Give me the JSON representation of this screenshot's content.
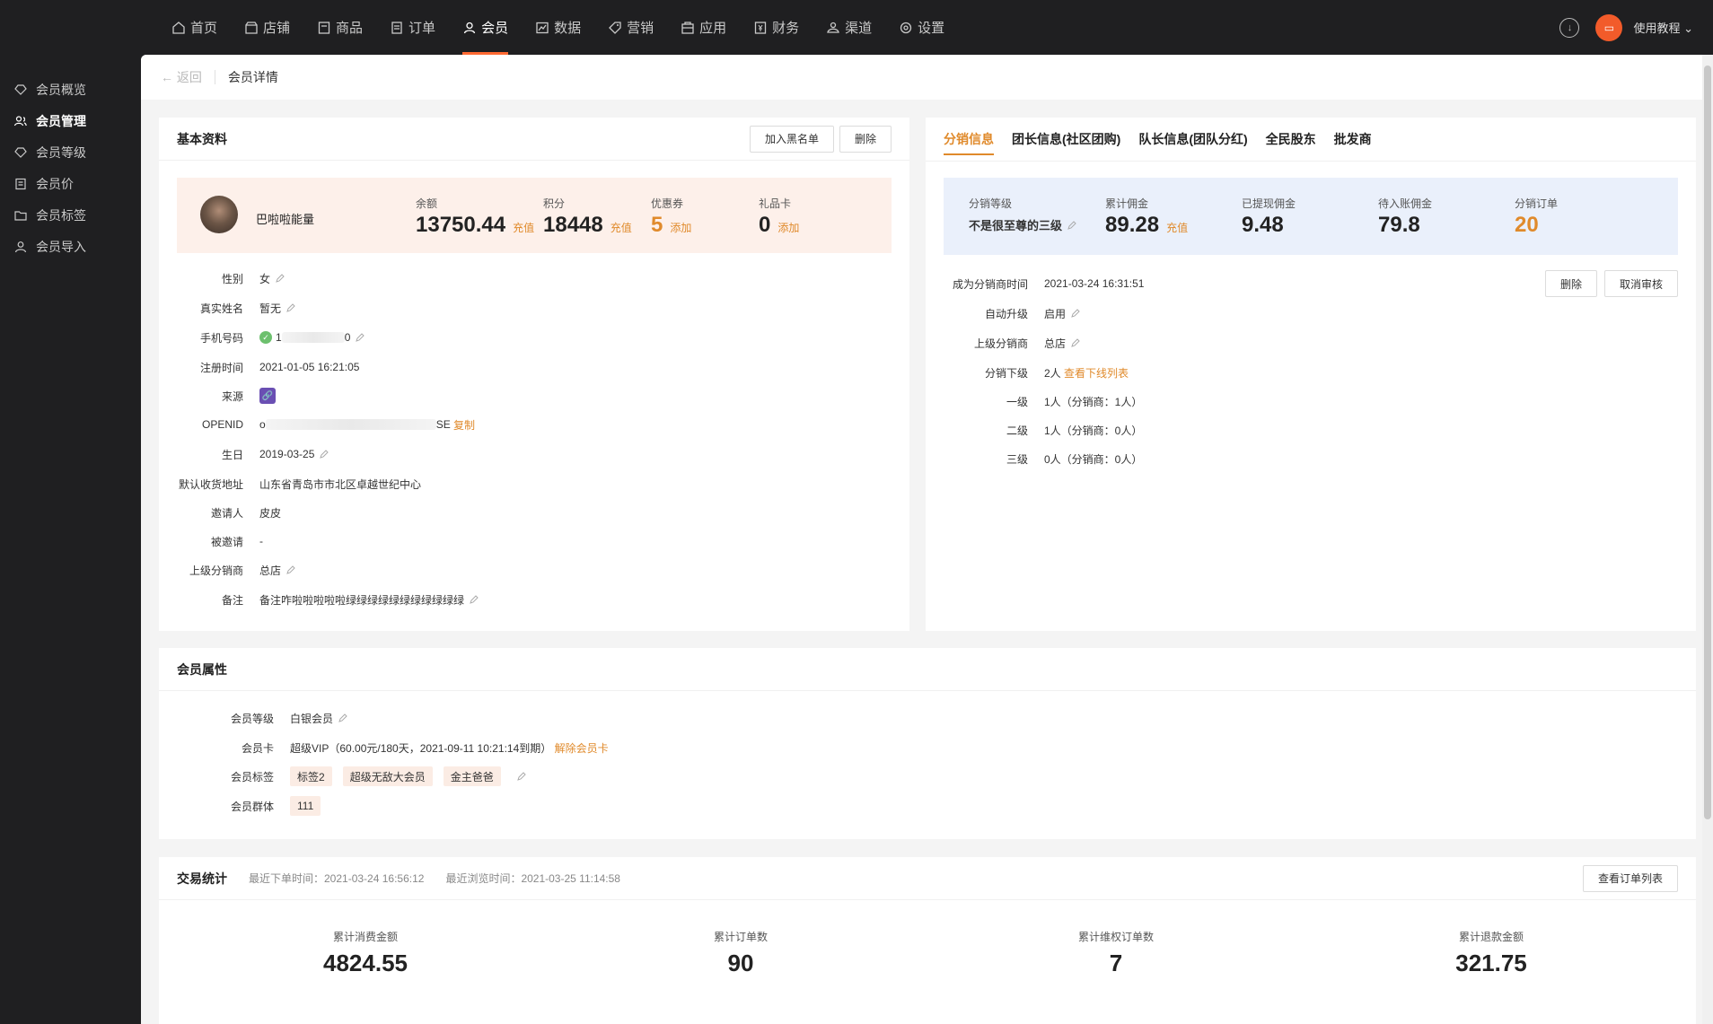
{
  "topnav": {
    "items": [
      {
        "label": "首页",
        "icon": "home-icon"
      },
      {
        "label": "店铺",
        "icon": "store-icon"
      },
      {
        "label": "商品",
        "icon": "goods-icon"
      },
      {
        "label": "订单",
        "icon": "order-icon"
      },
      {
        "label": "会员",
        "icon": "member-icon"
      },
      {
        "label": "数据",
        "icon": "chart-icon"
      },
      {
        "label": "营销",
        "icon": "tag-icon"
      },
      {
        "label": "应用",
        "icon": "app-icon"
      },
      {
        "label": "财务",
        "icon": "finance-icon"
      },
      {
        "label": "渠道",
        "icon": "channel-icon"
      },
      {
        "label": "设置",
        "icon": "gear-icon"
      }
    ],
    "active": "会员",
    "help_label": "使用教程"
  },
  "sidebar": {
    "items": [
      {
        "label": "会员概览"
      },
      {
        "label": "会员管理"
      },
      {
        "label": "会员等级"
      },
      {
        "label": "会员价"
      },
      {
        "label": "会员标签"
      },
      {
        "label": "会员导入"
      }
    ],
    "active": "会员管理"
  },
  "breadcrumb": {
    "back": "返回",
    "title": "会员详情"
  },
  "basic": {
    "title": "基本资料",
    "blacklist_btn": "加入黑名单",
    "delete_btn": "删除",
    "nickname": "巴啦啦能量",
    "stats": [
      {
        "label": "余额",
        "value": "13750.44",
        "action": "充值"
      },
      {
        "label": "积分",
        "value": "18448",
        "action": "充值"
      },
      {
        "label": "优惠券",
        "value": "5",
        "action": "添加"
      },
      {
        "label": "礼品卡",
        "value": "0",
        "action": "添加"
      }
    ],
    "rows": {
      "gender": {
        "k": "性别",
        "v": "女"
      },
      "realname": {
        "k": "真实姓名",
        "v": "暂无"
      },
      "phone": {
        "k": "手机号码",
        "v_start": "1",
        "v_end": "0"
      },
      "regtime": {
        "k": "注册时间",
        "v": "2021-01-05 16:21:05"
      },
      "source": {
        "k": "来源"
      },
      "openid": {
        "k": "OPENID",
        "v_start": "o",
        "v_end": "SE",
        "action": "复制"
      },
      "birthday": {
        "k": "生日",
        "v": "2019-03-25"
      },
      "address": {
        "k": "默认收货地址",
        "v": "山东省青岛市市北区卓越世纪中心"
      },
      "inviter": {
        "k": "邀请人",
        "v": "皮皮"
      },
      "invited": {
        "k": "被邀请",
        "v": "-"
      },
      "upline": {
        "k": "上级分销商",
        "v": "总店"
      },
      "remark": {
        "k": "备注",
        "v": "备注咋啦啦啦啦啦绿绿绿绿绿绿绿绿绿绿绿"
      }
    }
  },
  "distribution": {
    "tabs": [
      "分销信息",
      "团长信息(社区团购)",
      "队长信息(团队分红)",
      "全民股东",
      "批发商"
    ],
    "active_tab": "分销信息",
    "level": {
      "label": "分销等级",
      "value": "不是很至尊的三级"
    },
    "stats": [
      {
        "label": "累计佣金",
        "value": "89.28",
        "action": "充值"
      },
      {
        "label": "已提现佣金",
        "value": "9.48"
      },
      {
        "label": "待入账佣金",
        "value": "79.8"
      },
      {
        "label": "分销订单",
        "value": "20"
      }
    ],
    "delete_btn": "删除",
    "cancel_btn": "取消审核",
    "rows": {
      "since": {
        "k": "成为分销商时间",
        "v": "2021-03-24 16:31:51"
      },
      "autoup": {
        "k": "自动升级",
        "v": "启用"
      },
      "upline": {
        "k": "上级分销商",
        "v": "总店"
      },
      "down": {
        "k": "分销下级",
        "v": "2人",
        "action": "查看下线列表"
      },
      "l1": {
        "k": "一级",
        "v": "1人（分销商：1人）"
      },
      "l2": {
        "k": "二级",
        "v": "1人（分销商：0人）"
      },
      "l3": {
        "k": "三级",
        "v": "0人（分销商：0人）"
      }
    }
  },
  "attrs": {
    "title": "会员属性",
    "level": {
      "k": "会员等级",
      "v": "白银会员"
    },
    "card": {
      "k": "会员卡",
      "v": "超级VIP（60.00元/180天，2021-09-11 10:21:14到期）",
      "action": "解除会员卡"
    },
    "tags": {
      "k": "会员标签",
      "items": [
        "标签2",
        "超级无敌大会员",
        "金主爸爸"
      ]
    },
    "groups": {
      "k": "会员群体",
      "items": [
        "111"
      ]
    }
  },
  "trade": {
    "title": "交易统计",
    "last_order": "最近下单时间：2021-03-24 16:56:12",
    "last_visit": "最近浏览时间：2021-03-25 11:14:58",
    "orders_btn": "查看订单列表",
    "stats": [
      {
        "label": "累计消费金额",
        "value": "4824.55"
      },
      {
        "label": "累计订单数",
        "value": "90"
      },
      {
        "label": "累计维权订单数",
        "value": "7"
      },
      {
        "label": "累计退款金额",
        "value": "321.75"
      }
    ]
  }
}
